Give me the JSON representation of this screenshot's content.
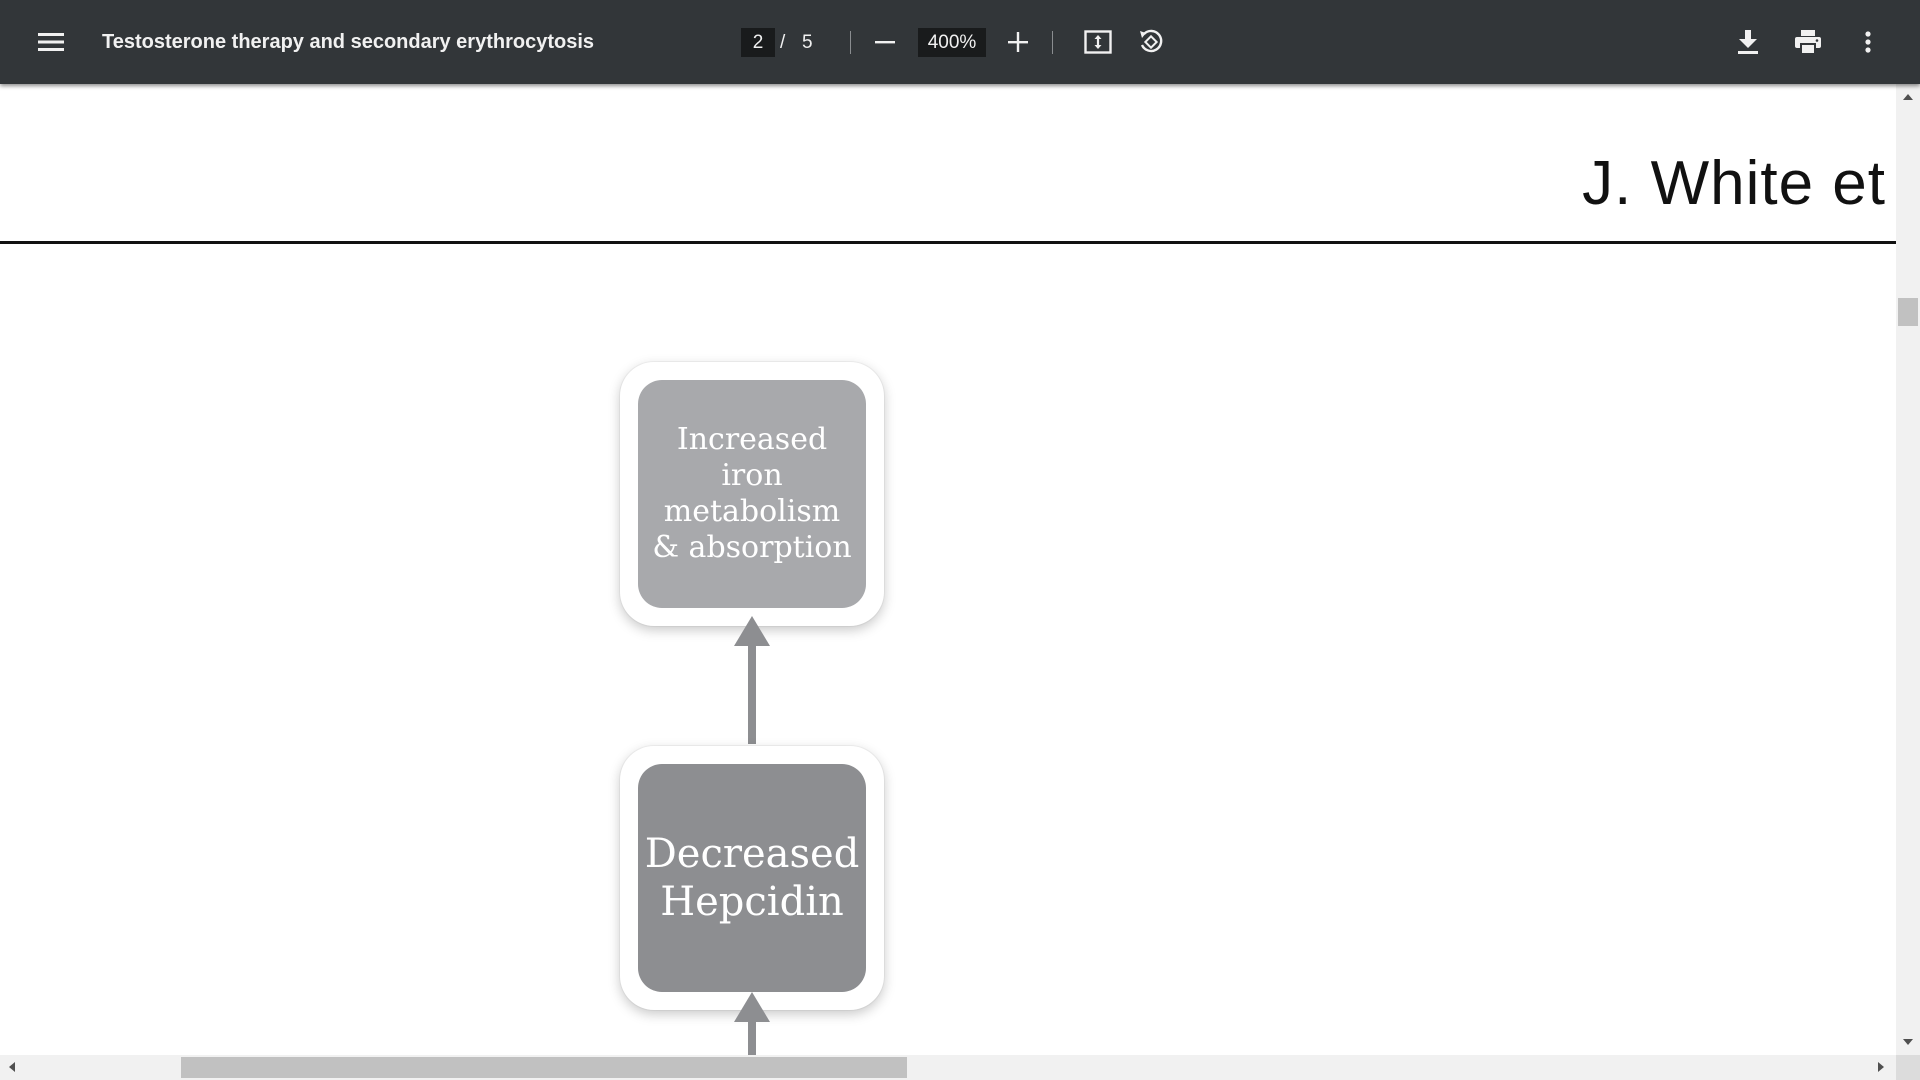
{
  "toolbar": {
    "title": "Testosterone therapy and secondary erythrocytosis",
    "current_page": "2",
    "page_separator": "/",
    "total_pages": "5",
    "zoom": "400%",
    "icons": {
      "menu": "hamburger-menu-icon",
      "zoom_out": "minus-icon",
      "zoom_in": "plus-icon",
      "fit": "fit-to-page-icon",
      "rotate": "rotate-counterclockwise-icon",
      "download": "download-icon",
      "print": "print-icon",
      "more": "more-vertical-icon"
    }
  },
  "document": {
    "running_head": "J. White et",
    "flowchart": {
      "box_top": "Increased iron metabolism & absorption",
      "box_bottom_line1": "Decreased",
      "box_bottom_line2": "Hepcidin"
    }
  },
  "colors": {
    "toolbar_bg": "#323639",
    "box_light": "#a8a9ac",
    "box_dark": "#8d8e91"
  }
}
